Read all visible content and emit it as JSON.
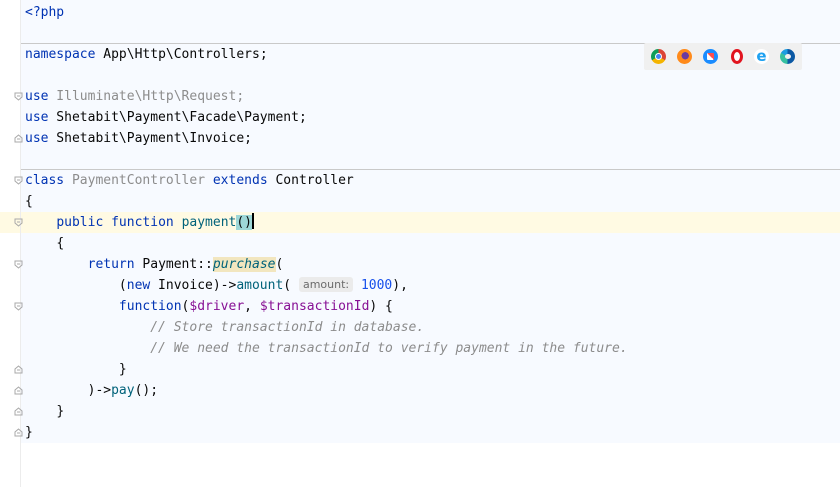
{
  "editor": {
    "lines": {
      "l1": "<?php",
      "ns_kw": "namespace",
      "ns_name": " App\\Http\\Controllers;",
      "use_kw": "use",
      "use1": " Illuminate\\Http\\Request;",
      "use2": " Shetabit\\Payment\\Facade\\Payment;",
      "use3": " Shetabit\\Payment\\Invoice;",
      "class_kw": "class",
      "class_name": " PaymentController ",
      "extends_kw": "extends",
      "parent": " Controller",
      "brace_open": "{",
      "public_kw": "public",
      "function_kw": "function",
      "method": "payment",
      "parens": "()",
      "return_kw": "return",
      "facade": " Payment::",
      "purchase": "purchase",
      "open_paren": "(",
      "new_open": "(",
      "new_kw": "new",
      "invoice_call": " Invoice)->",
      "amount_fn": "amount",
      "amount_hint": "amount:",
      "amount_val": "1000",
      "amount_end": "),",
      "closure_kw": "function",
      "closure_open": "(",
      "driver": "$driver",
      "comma": ", ",
      "tx": "$transactionId",
      "closure_end": ") {",
      "comment1": "// Store transactionId in database.",
      "comment2": "// We need the transactionId to verify payment in the future.",
      "inner_close": "}",
      "pay_prefix": ")->",
      "pay_fn": "pay",
      "pay_end": "();",
      "method_close": "}",
      "class_close": "}"
    }
  },
  "browser_icons": [
    "chrome-icon",
    "firefox-icon",
    "safari-icon",
    "opera-icon",
    "ie-icon",
    "edge-icon"
  ],
  "ie_glyph": "e",
  "colors": {
    "keyword": "#0033b3",
    "function": "#00627a",
    "number": "#1750eb",
    "comment": "#8c8c8c",
    "variable": "#871094",
    "current_line": "#fffae3"
  }
}
